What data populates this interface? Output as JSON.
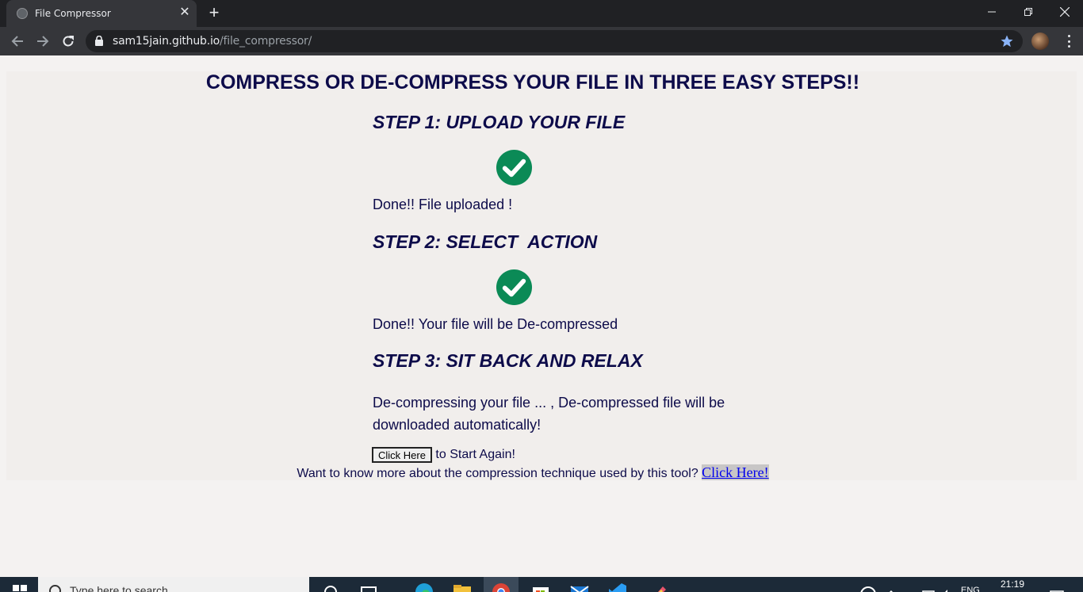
{
  "browser": {
    "tab_title": "File Compressor",
    "tab_close": "✕",
    "new_tab": "+",
    "url_host": "sam15jain.github.io",
    "url_path": "/file_compressor/"
  },
  "page": {
    "title": "COMPRESS OR DE-COMPRESS YOUR FILE IN THREE EASY STEPS!!",
    "step1": {
      "title": "STEP 1: UPLOAD YOUR FILE",
      "status": "Done!! File uploaded !"
    },
    "step2": {
      "title": "STEP 2: SELECT  ACTION",
      "status": "Done!! Your file will be De-compressed"
    },
    "step3": {
      "title": "STEP 3: SIT BACK AND RELAX",
      "status": "De-compressing your file ... , De-compressed file will be downloaded automatically!"
    },
    "restart_button": "Click Here",
    "restart_suffix": " to Start Again!",
    "more_text": "Want to know more about the compression technique used by this tool? ",
    "more_link": "Click Here!",
    "check_color": "#0b8a56"
  },
  "taskbar": {
    "search_placeholder": "Type here to search",
    "language": "ENG",
    "time": "21:19"
  }
}
